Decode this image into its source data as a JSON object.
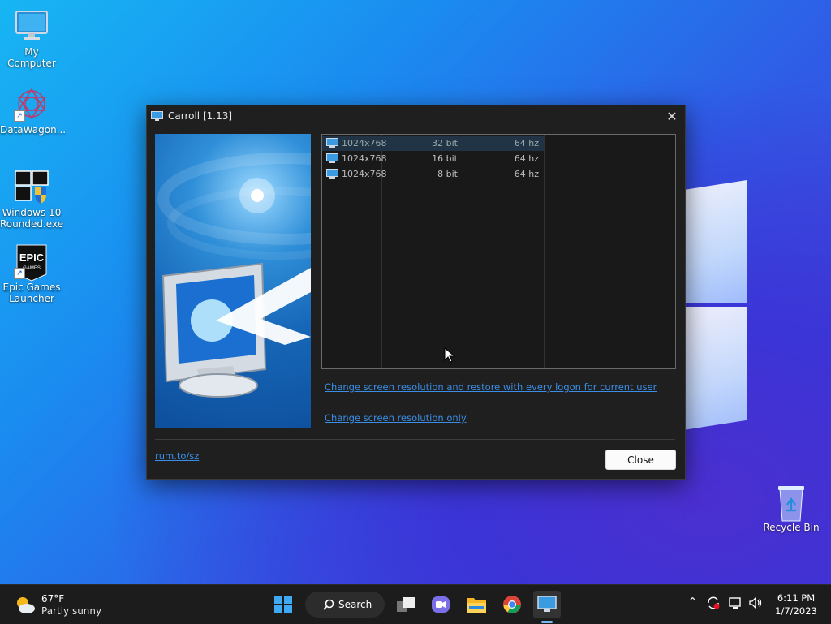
{
  "desktop": {
    "icons": [
      {
        "label": "My Computer",
        "icon": "monitor-icon"
      },
      {
        "label": "DataWagon...",
        "icon": "spiral-icon"
      },
      {
        "label_line1": "Windows 10",
        "label_line2": "Rounded.exe",
        "icon": "windows-shield-icon"
      },
      {
        "label_line1": "Epic Games",
        "label_line2": "Launcher",
        "icon": "epic-games-icon"
      },
      {
        "label": "Recycle Bin",
        "icon": "recycle-bin-icon"
      }
    ]
  },
  "dialog": {
    "title": "Carroll [1.13]",
    "modes": [
      {
        "resolution": "1024x768",
        "depth": "32 bit",
        "refresh": "64 hz",
        "selected": true
      },
      {
        "resolution": "1024x768",
        "depth": "16 bit",
        "refresh": "64 hz",
        "selected": false
      },
      {
        "resolution": "1024x768",
        "depth": "8 bit",
        "refresh": "64 hz",
        "selected": false
      }
    ],
    "link_restore": "Change screen resolution and restore with every logon for current user",
    "link_only": "Change screen resolution only",
    "footer_link": "rum.to/sz",
    "close_label": "Close"
  },
  "taskbar": {
    "weather_temp": "67°F",
    "weather_condition": "Partly sunny",
    "search_label": "Search",
    "time": "6:11 PM",
    "date": "1/7/2023"
  },
  "colors": {
    "accent_link": "#3a8ee6",
    "dialog_bg": "#1f1f1f",
    "taskbar_bg": "#1c1c1c"
  }
}
